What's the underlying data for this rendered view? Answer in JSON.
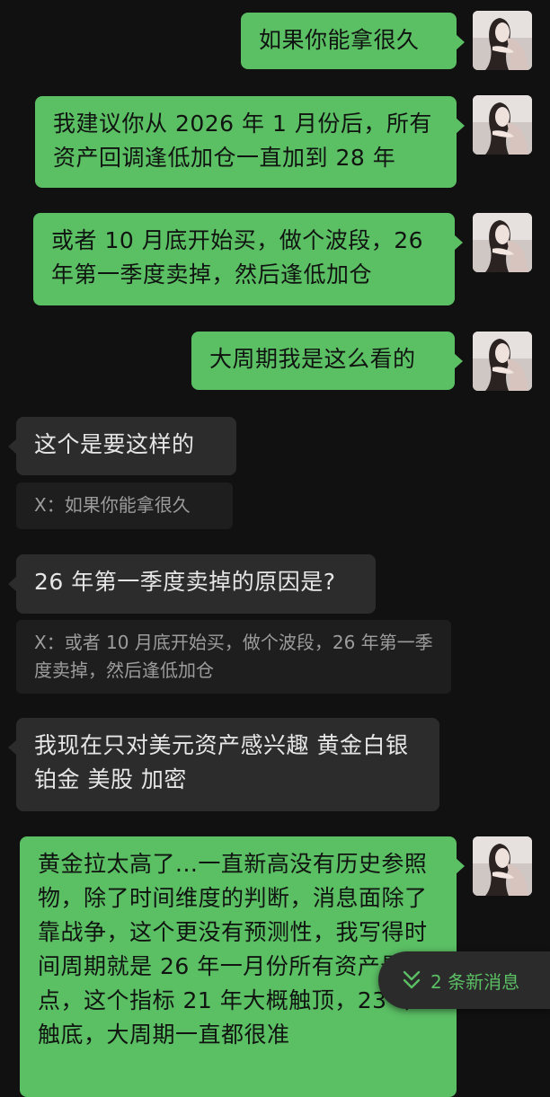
{
  "messages": [
    {
      "side": "out",
      "text": "如果你能拿很久"
    },
    {
      "side": "out",
      "text": "我建议你从 2026 年 1 月份后，所有资产回调逢低加仓一直加到 28 年"
    },
    {
      "side": "out",
      "text": "或者 10 月底开始买，做个波段，26 年第一季度卖掉，然后逢低加仓"
    },
    {
      "side": "out",
      "text": "大周期我是这么看的"
    },
    {
      "side": "in",
      "text": "这个是要这样的",
      "quote": "X：如果你能拿很久"
    },
    {
      "side": "in",
      "text": "26 年第一季度卖掉的原因是?",
      "quote": "X：或者 10 月底开始买，做个波段，26 年第一季度卖掉，然后逢低加仓"
    },
    {
      "side": "in",
      "text": "我现在只对美元资产感兴趣 黄金白银 铂金 美股 加密"
    },
    {
      "side": "out",
      "text": "黄金拉太高了...一直新高没有历史参照物，除了时间维度的判断，消息面除了靠战争，这个更没有预测性，我写得时间周期就是 26 年一月份所有资产最高点，这个指标 21 年大概触顶，23 年触底，大周期一直都很准"
    }
  ],
  "new_messages": {
    "label": "2 条新消息",
    "icon": "double-chevron-down-icon"
  },
  "colors": {
    "background": "#111111",
    "sent_bubble": "#5bbf64",
    "received_bubble": "#2c2c2c",
    "quote_bg": "#1e1e1e",
    "accent": "#5bbf64"
  }
}
